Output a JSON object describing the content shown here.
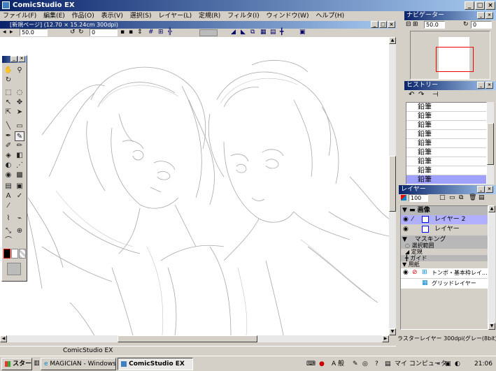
{
  "app": {
    "title": "ComicStudio EX",
    "menu": [
      "ファイル(F)",
      "編集(E)",
      "作品(O)",
      "表示(V)",
      "選択(S)",
      "レイヤー(L)",
      "定規(R)",
      "フィルタ(I)",
      "ウィンドウ(W)",
      "ヘルプ(H)"
    ]
  },
  "doc": {
    "title": "[新規ページ] (12.70 × 15.24cm 300dpi)",
    "zoom": "50.0",
    "rotation": "0",
    "status": "ComicStudio EX"
  },
  "navigator": {
    "title": "ナビゲーター",
    "zoom": "50.0",
    "rotation": "0"
  },
  "history": {
    "title": "ヒストリー",
    "items": [
      "鉛筆",
      "鉛筆",
      "鉛筆",
      "鉛筆",
      "鉛筆",
      "鉛筆",
      "鉛筆",
      "鉛筆",
      "鉛筆"
    ],
    "selected": "鉛筆"
  },
  "layers": {
    "title": "レイヤー",
    "opacity": "100",
    "group_image": "画像",
    "layer2": "レイヤー 2",
    "layer1": "レイヤー",
    "masking": "マスキング",
    "selection": "選択範囲",
    "ruler": "定規",
    "guide": "ガイド",
    "paper": "用紙",
    "tombo": "トンボ・基本枠レイ...",
    "grid": "グリッドレイヤー",
    "status": "ラスターレイヤー 300dpi(グレー(8bit))"
  },
  "taskbar": {
    "start": "スタート",
    "task1": "MAGICIAN - Windows In...",
    "task2": "ComicStudio EX",
    "ime": "A 般",
    "computer": "マイ コンピュータ",
    "clock": "21:06"
  }
}
